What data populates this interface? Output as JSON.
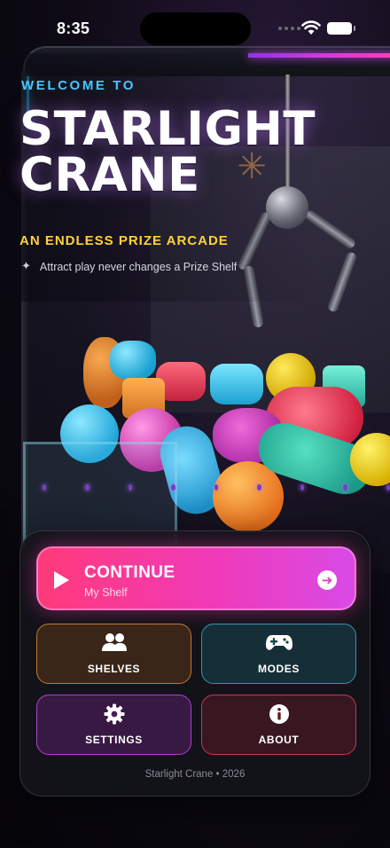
{
  "status_bar": {
    "time": "8:35",
    "wifi_icon": "wifi-icon",
    "battery_icon": "battery-icon"
  },
  "header": {
    "eyebrow": "WELCOME TO",
    "title_line1": "STARLIGHT",
    "title_line2": "CRANE",
    "subtitle": "AN ENDLESS PRIZE ARCADE",
    "tagline": "Attract play never changes a Prize Shelf",
    "tagline_icon": "sparkle-icon"
  },
  "menu": {
    "continue": {
      "label": "CONTINUE",
      "sublabel": "My Shelf",
      "icon": "play-icon",
      "trailing_icon": "arrow-right-circle-icon"
    },
    "tiles": [
      {
        "label": "SHELVES",
        "icon": "users-icon"
      },
      {
        "label": "MODES",
        "icon": "gamepad-icon"
      },
      {
        "label": "SETTINGS",
        "icon": "gear-icon"
      },
      {
        "label": "ABOUT",
        "icon": "info-icon"
      }
    ],
    "footer": "Starlight Crane • 2026"
  },
  "colors": {
    "eyebrow": "#46c8ff",
    "subtitle": "#ffd23a",
    "continue_gradient_start": "#ff3a7a",
    "continue_gradient_end": "#d84ae6",
    "shelves_border": "#c27a2c",
    "modes_border": "#2f98b0",
    "settings_border": "#b040d0",
    "about_border": "#c03a52"
  }
}
